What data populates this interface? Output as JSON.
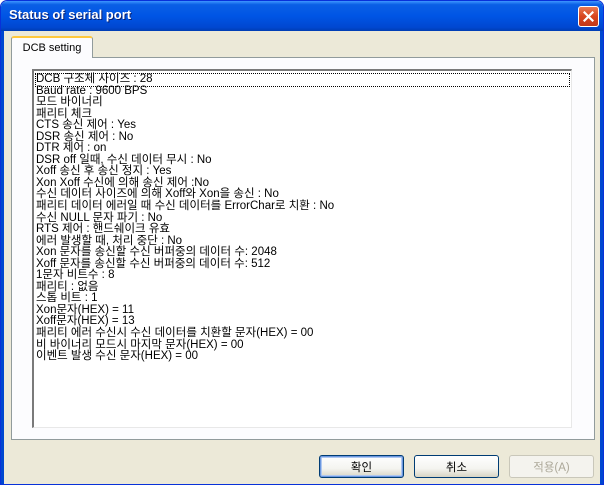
{
  "window": {
    "title": "Status of serial port",
    "colors": {
      "titlebar": "#0055e5",
      "face": "#ece9d8",
      "tab_accent": "#ffc83c",
      "close": "#d8451e"
    }
  },
  "tabs": [
    {
      "label": "DCB setting",
      "selected": true
    }
  ],
  "text_lines": [
    "DCB 구조체 사이즈 : 28",
    "Baud rate : 9600 BPS",
    "모드 바이너리",
    "패리티 체크",
    "CTS 송신 제어 : Yes",
    "DSR 송신 제어 : No",
    "DTR 제어 : on",
    "DSR off 일때, 수신 데이터 무시 : No",
    "Xoff 송신 후 송신 정지 : Yes",
    "Xon Xoff 수신에 의해 송신 제어 :No",
    "수신 데이터 사이즈에 의해 Xoff와 Xon을 송신 : No",
    "패리티 데이터 에러일 때 수신 데이터를 ErrorChar로 치환 : No",
    "수신 NULL 문자 파기 : No",
    "RTS 제어 : 핸드쉐이크 유효",
    "에러 발생할 때, 처리 중단 : No",
    "Xon 문자를 송신할 수신 버퍼중의 데이터 수: 2048",
    "Xoff 문자를 송신할 수신 버퍼중의 데이터 수: 512",
    "1문자 비트수 : 8",
    "패리티 : 없음",
    "스톱 비트 : 1",
    "Xon문자(HEX) = 11",
    "Xoff문자(HEX) = 13",
    "패리티 에러 수신시 수신 데이터를 치환할 문자(HEX) = 00",
    "비 바이너리 모드시 마지막 문자(HEX) = 00",
    "이벤트 발생 수신 문자(HEX) = 00"
  ],
  "buttons": {
    "ok": "확인",
    "cancel": "취소",
    "apply": "적용(A)"
  },
  "icons": {
    "close": "close-icon"
  }
}
